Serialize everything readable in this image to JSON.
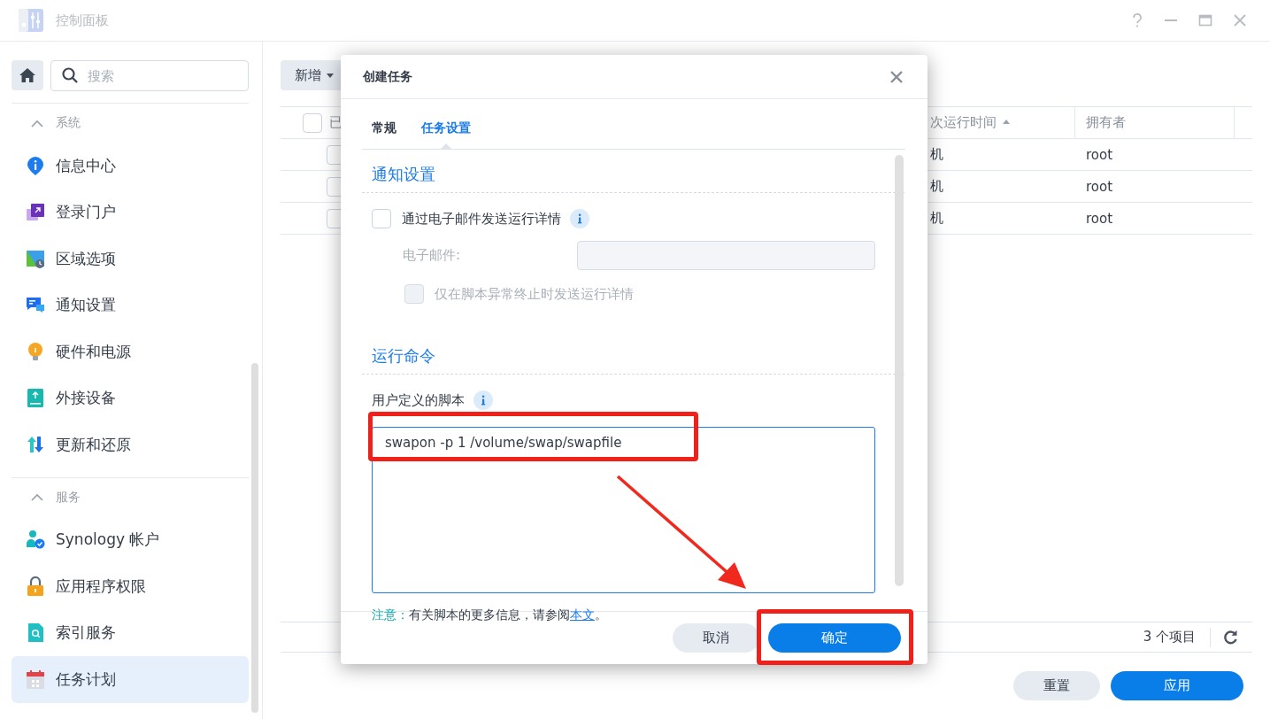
{
  "window": {
    "title": "控制面板"
  },
  "sidebar": {
    "search": {
      "placeholder": "搜索"
    },
    "sections": [
      {
        "title": "系统",
        "expanded": true,
        "items": [
          {
            "label": "信息中心",
            "selected": false
          },
          {
            "label": "登录门户",
            "selected": false
          },
          {
            "label": "区域选项",
            "selected": false
          },
          {
            "label": "通知设置",
            "selected": false
          },
          {
            "label": "硬件和电源",
            "selected": false
          },
          {
            "label": "外接设备",
            "selected": false
          },
          {
            "label": "更新和还原",
            "selected": false
          }
        ]
      },
      {
        "title": "服务",
        "expanded": true,
        "items": [
          {
            "label": "Synology 帐户",
            "selected": false
          },
          {
            "label": "应用程序权限",
            "selected": false
          },
          {
            "label": "索引服务",
            "selected": false
          },
          {
            "label": "任务计划",
            "selected": true
          }
        ]
      }
    ]
  },
  "toolbar": {
    "add_button": "新增"
  },
  "table": {
    "header_checked": false,
    "columns": [
      {
        "label": "已",
        "sorted": false
      },
      {
        "label": "次运行时间",
        "sorted": true
      },
      {
        "label": "拥有者",
        "sorted": false
      }
    ],
    "rows": [
      {
        "checked": false,
        "cells": [
          "",
          "机",
          "root"
        ]
      },
      {
        "checked": false,
        "cells": [
          "",
          "机",
          "root"
        ]
      },
      {
        "checked": false,
        "cells": [
          "",
          "机",
          "root"
        ]
      }
    ]
  },
  "pager": {
    "count": "3 个项目"
  },
  "footer_buttons": [
    {
      "label": "重置",
      "kind": "secondary"
    },
    {
      "label": "应用",
      "kind": "primary"
    }
  ],
  "dialog": {
    "title": "创建任务",
    "tabs": [
      {
        "label": "常规",
        "selected": false
      },
      {
        "label": "任务设置",
        "selected": true
      }
    ],
    "notification": {
      "heading": "通知设置",
      "email_option": {
        "label": "通过电子邮件发送运行详情",
        "checked": false
      },
      "email_field": {
        "label": "电子邮件:",
        "disabled": true
      },
      "abnormal_option": {
        "label": "仅在脚本异常终止时发送运行详情",
        "checked": false,
        "disabled": true
      }
    },
    "command": {
      "heading": "运行命令",
      "script_label": "用户定义的脚本",
      "script": "swapon -p 1 /volume/swap/swapfile"
    },
    "note": {
      "label": "注意：",
      "text": "有关脚本的更多信息，请参阅",
      "link": "本文",
      "end": "。"
    },
    "buttons": [
      {
        "label": "取消",
        "kind": "secondary"
      },
      {
        "label": "确定",
        "kind": "primary"
      }
    ]
  },
  "annotations": [
    {
      "kind": "frame"
    },
    {
      "kind": "arrow"
    },
    {
      "kind": "frame"
    }
  ]
}
